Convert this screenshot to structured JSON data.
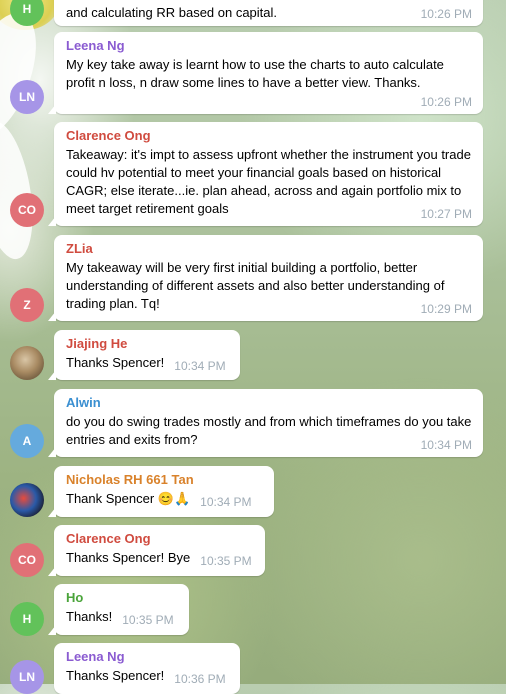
{
  "messages": [
    {
      "sender": "",
      "avatar_initials": "H",
      "avatar_color": "#62c25a",
      "text": "and calculating RR based on capital.",
      "time": "10:26 PM"
    },
    {
      "sender": "Leena Ng",
      "sender_color": "#8a5bd1",
      "avatar_initials": "LN",
      "avatar_color": "#a695e7",
      "text": "My key take away is learnt how to use the charts to auto calculate profit n loss, n draw some lines to have a better view. Thanks.",
      "time": "10:26 PM"
    },
    {
      "sender": "Clarence Ong",
      "sender_color": "#d04b3f",
      "avatar_initials": "CO",
      "avatar_color": "#e17076",
      "text": "Takeaway: it's impt to assess upfront whether the instrument you trade could hv potential to meet your financial goals based on historical CAGR; else iterate...ie. plan ahead, across and again portfolio mix to meet target retirement goals",
      "time": "10:27 PM"
    },
    {
      "sender": "ZLia",
      "sender_color": "#d04b3f",
      "avatar_initials": "Z",
      "avatar_color": "#e17076",
      "text": "My takeaway will be very first initial building a portfolio, better understanding of different assets and also better understanding of trading plan. Tq!",
      "time": "10:29 PM"
    },
    {
      "sender": "Jiajing He",
      "sender_color": "#d04b3f",
      "avatar_initials": "",
      "text": "Thanks Spencer!",
      "time": "10:34 PM"
    },
    {
      "sender": "Alwin",
      "sender_color": "#3a8fd1",
      "avatar_initials": "A",
      "avatar_color": "#65aadd",
      "text": "do you do swing trades mostly and from which timeframes do you take entries and exits from?",
      "time": "10:34 PM"
    },
    {
      "sender": "Nicholas RH 661 Tan",
      "sender_color": "#d9822b",
      "avatar_initials": "",
      "text": "Thank Spencer 😊🙏",
      "time": "10:34 PM"
    },
    {
      "sender": "Clarence Ong",
      "sender_color": "#d04b3f",
      "avatar_initials": "CO",
      "avatar_color": "#e17076",
      "text": "Thanks Spencer! Bye",
      "time": "10:35 PM"
    },
    {
      "sender": "Ho",
      "sender_color": "#4aa43a",
      "avatar_initials": "H",
      "avatar_color": "#62c25a",
      "text": "Thanks!",
      "time": "10:35 PM"
    },
    {
      "sender": "Leena Ng",
      "sender_color": "#8a5bd1",
      "avatar_initials": "LN",
      "avatar_color": "#a695e7",
      "text": "Thanks Spencer!",
      "time": "10:36 PM"
    }
  ]
}
